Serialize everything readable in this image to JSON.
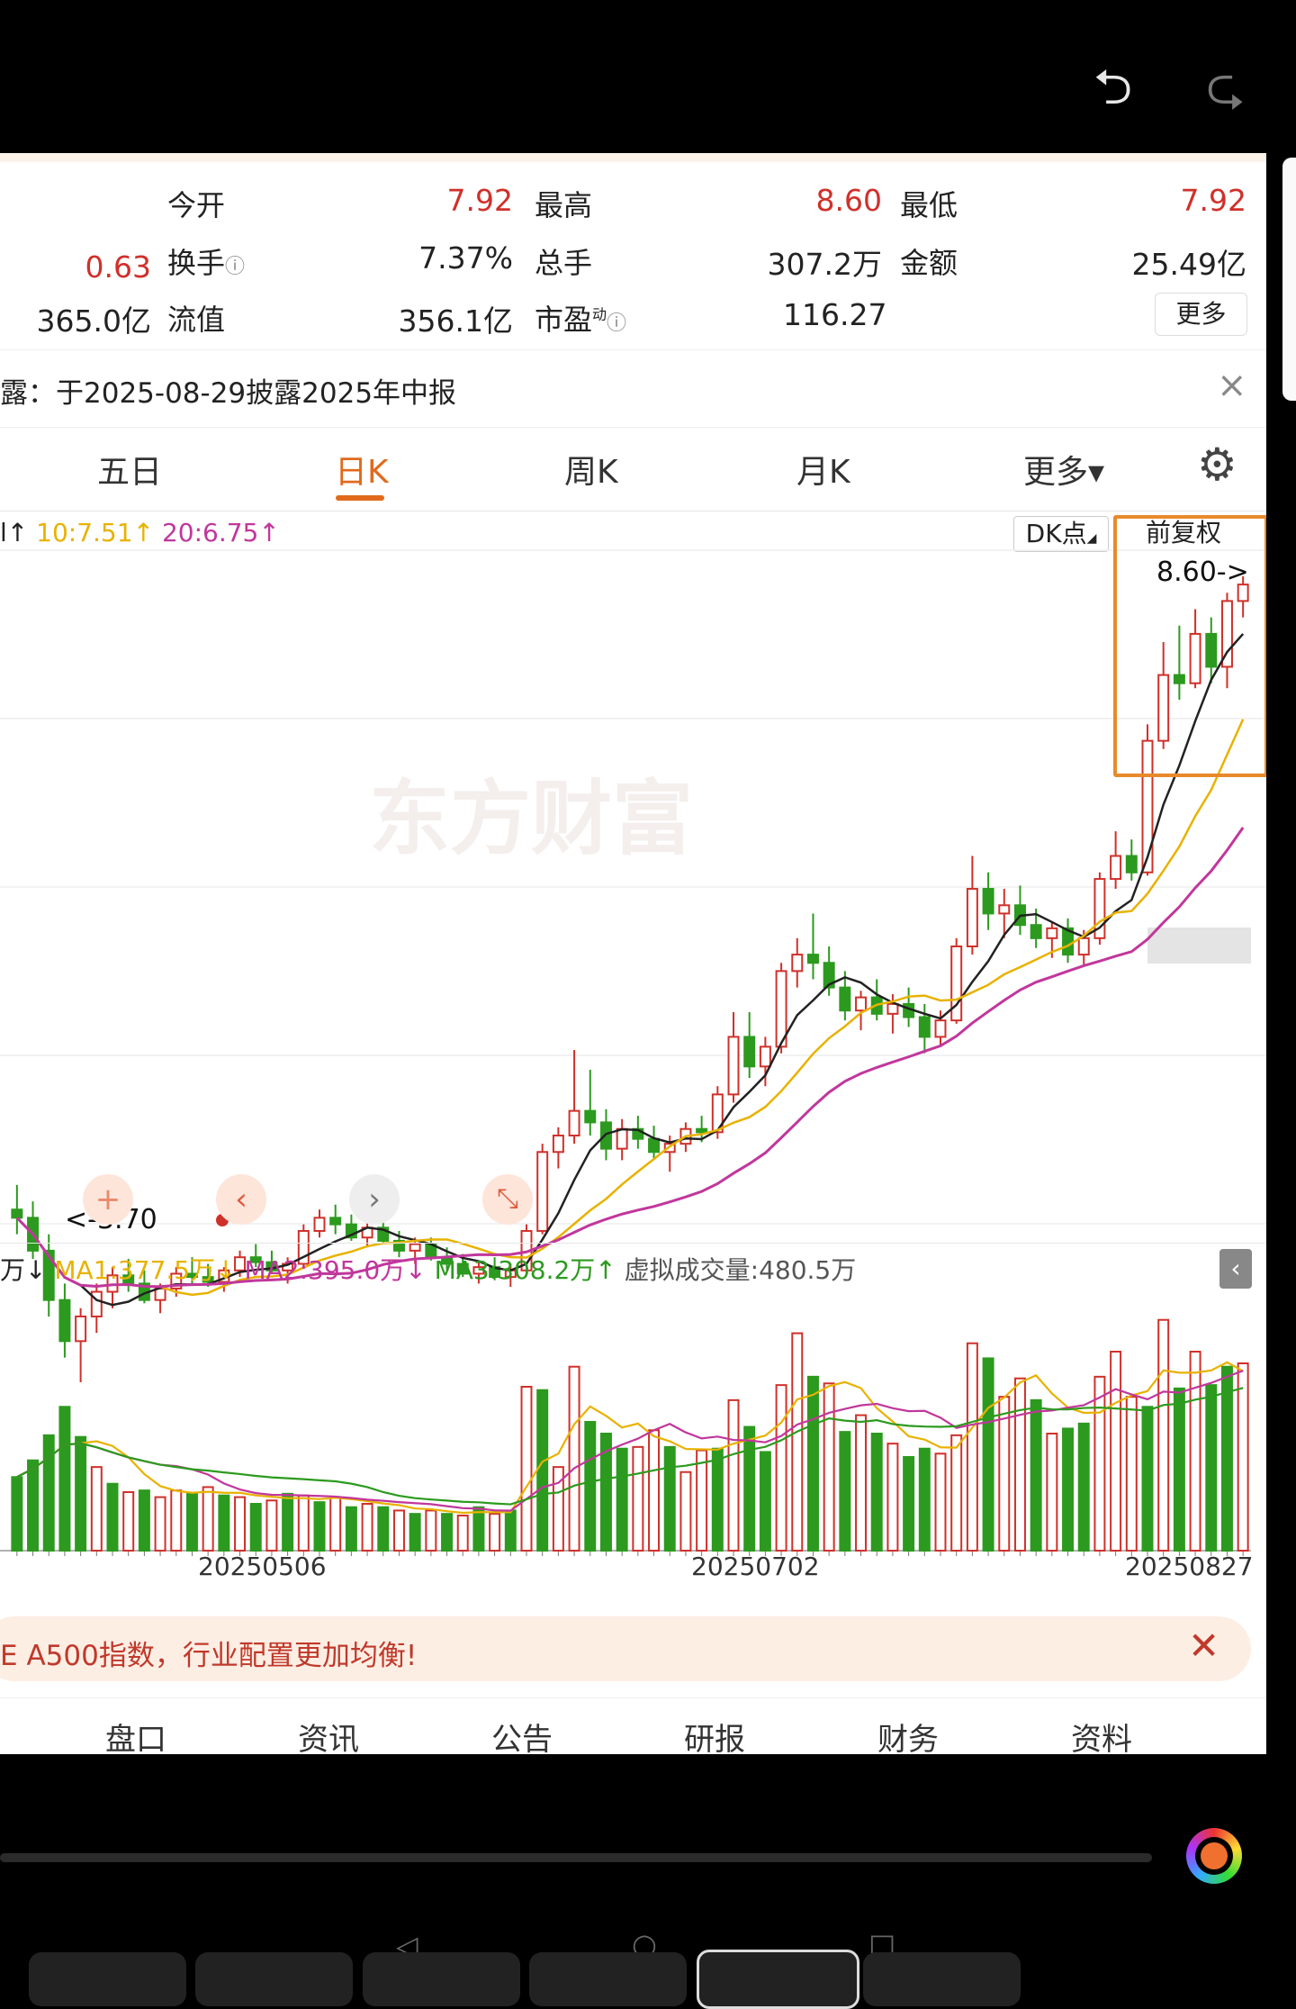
{
  "system": {
    "back_icon": "undo-arrow-icon",
    "forward_icon": "redo-arrow-icon"
  },
  "quote": {
    "row1": {
      "l1": "今开",
      "v1": "7.92",
      "l2": "最高",
      "v2": "8.60",
      "l3": "最低",
      "v3": "7.92"
    },
    "row2": {
      "v0": "0.63",
      "l1": "换手",
      "v1": "7.37%",
      "l2": "总手",
      "v2": "307.2万",
      "l3": "金额",
      "v3": "25.49亿"
    },
    "row3": {
      "v0": "365.0亿",
      "l1": "流值",
      "v1": "356.1亿",
      "l2": "市盈",
      "l2_sup": "动",
      "v2": "116.27"
    },
    "more": "更多"
  },
  "notice": {
    "text": "露：于2025-08-29披露2025年中报"
  },
  "tabs": [
    {
      "label": "五日",
      "active": false
    },
    {
      "label": "日K",
      "active": true
    },
    {
      "label": "周K",
      "active": false
    },
    {
      "label": "月K",
      "active": false
    },
    {
      "label": "更多▾",
      "active": false
    }
  ],
  "ma_line": {
    "m1": "l↑",
    "m2": "10:7.51↑",
    "m3": "20:6.75↑"
  },
  "chip_dk": "DK点",
  "chip_fq": "前复权",
  "price_high_label": "8.60->",
  "price_low_label": "<-3.70",
  "watermark": "东方财富",
  "vol_line": {
    "v0": "万↓",
    "v1": "MA1:377.5万↓",
    "v2": "MA2:395.0万↓",
    "v3": "MA3:308.2万↑",
    "v4": "虚拟成交量:480.5万"
  },
  "dates": [
    "20250506",
    "20250702",
    "20250827"
  ],
  "banner": {
    "text": "E A500指数，行业配置更加均衡!"
  },
  "bottom_nav": [
    "盘口",
    "资讯",
    "公告",
    "研报",
    "财务",
    "资料"
  ],
  "colors": {
    "up": "#d0302a",
    "down": "#2c9a1e",
    "ma5": "#222222",
    "ma10": "#e8b200",
    "ma20": "#c1379c",
    "accent": "#e06a1c"
  },
  "chart_data": {
    "type": "candlestick",
    "price_range": [
      3.7,
      8.6
    ],
    "candles": [
      [
        4.75,
        4.9,
        4.6,
        4.7
      ],
      [
        4.7,
        4.8,
        4.45,
        4.5
      ],
      [
        4.5,
        4.6,
        4.1,
        4.2
      ],
      [
        4.2,
        4.3,
        3.85,
        3.95
      ],
      [
        3.95,
        4.15,
        3.7,
        4.1
      ],
      [
        4.1,
        4.3,
        4.0,
        4.25
      ],
      [
        4.25,
        4.4,
        4.15,
        4.35
      ],
      [
        4.35,
        4.45,
        4.25,
        4.3
      ],
      [
        4.3,
        4.38,
        4.18,
        4.2
      ],
      [
        4.2,
        4.3,
        4.12,
        4.27
      ],
      [
        4.27,
        4.4,
        4.22,
        4.36
      ],
      [
        4.36,
        4.46,
        4.3,
        4.34
      ],
      [
        4.34,
        4.42,
        4.28,
        4.31
      ],
      [
        4.31,
        4.4,
        4.25,
        4.38
      ],
      [
        4.38,
        4.5,
        4.34,
        4.46
      ],
      [
        4.46,
        4.54,
        4.4,
        4.43
      ],
      [
        4.43,
        4.5,
        4.36,
        4.38
      ],
      [
        4.38,
        4.46,
        4.3,
        4.42
      ],
      [
        4.42,
        4.66,
        4.4,
        4.62
      ],
      [
        4.62,
        4.75,
        4.58,
        4.7
      ],
      [
        4.7,
        4.78,
        4.6,
        4.66
      ],
      [
        4.66,
        4.72,
        4.56,
        4.58
      ],
      [
        4.58,
        4.68,
        4.52,
        4.64
      ],
      [
        4.64,
        4.7,
        4.54,
        4.56
      ],
      [
        4.56,
        4.62,
        4.46,
        4.5
      ],
      [
        4.5,
        4.58,
        4.42,
        4.54
      ],
      [
        4.54,
        4.58,
        4.44,
        4.46
      ],
      [
        4.46,
        4.52,
        4.38,
        4.42
      ],
      [
        4.42,
        4.48,
        4.34,
        4.36
      ],
      [
        4.36,
        4.44,
        4.3,
        4.4
      ],
      [
        4.4,
        4.46,
        4.32,
        4.34
      ],
      [
        4.34,
        4.42,
        4.28,
        4.38
      ],
      [
        4.38,
        4.66,
        4.36,
        4.62
      ],
      [
        4.62,
        5.15,
        4.6,
        5.1
      ],
      [
        5.1,
        5.25,
        5.0,
        5.2
      ],
      [
        5.2,
        5.72,
        5.15,
        5.35
      ],
      [
        5.35,
        5.6,
        5.2,
        5.28
      ],
      [
        5.28,
        5.36,
        5.05,
        5.12
      ],
      [
        5.12,
        5.3,
        5.05,
        5.24
      ],
      [
        5.24,
        5.32,
        5.12,
        5.18
      ],
      [
        5.18,
        5.26,
        5.06,
        5.1
      ],
      [
        5.1,
        5.2,
        4.98,
        5.15
      ],
      [
        5.15,
        5.28,
        5.1,
        5.24
      ],
      [
        5.24,
        5.32,
        5.16,
        5.22
      ],
      [
        5.22,
        5.5,
        5.18,
        5.45
      ],
      [
        5.45,
        5.95,
        5.4,
        5.8
      ],
      [
        5.8,
        5.95,
        5.55,
        5.62
      ],
      [
        5.62,
        5.8,
        5.5,
        5.74
      ],
      [
        5.74,
        6.25,
        5.7,
        6.2
      ],
      [
        6.2,
        6.4,
        6.1,
        6.3
      ],
      [
        6.3,
        6.55,
        6.15,
        6.25
      ],
      [
        6.25,
        6.35,
        6.05,
        6.1
      ],
      [
        6.1,
        6.2,
        5.9,
        5.96
      ],
      [
        5.96,
        6.08,
        5.84,
        6.04
      ],
      [
        6.04,
        6.15,
        5.9,
        5.94
      ],
      [
        5.94,
        6.06,
        5.82,
        6.0
      ],
      [
        6.0,
        6.1,
        5.86,
        5.92
      ],
      [
        5.92,
        6.0,
        5.7,
        5.8
      ],
      [
        5.8,
        5.96,
        5.74,
        5.9
      ],
      [
        5.9,
        6.4,
        5.88,
        6.35
      ],
      [
        6.35,
        6.9,
        6.3,
        6.7
      ],
      [
        6.7,
        6.8,
        6.45,
        6.55
      ],
      [
        6.55,
        6.7,
        6.4,
        6.6
      ],
      [
        6.6,
        6.72,
        6.42,
        6.48
      ],
      [
        6.48,
        6.58,
        6.34,
        6.4
      ],
      [
        6.4,
        6.5,
        6.28,
        6.46
      ],
      [
        6.46,
        6.52,
        6.25,
        6.3
      ],
      [
        6.3,
        6.45,
        6.24,
        6.4
      ],
      [
        6.4,
        6.8,
        6.36,
        6.76
      ],
      [
        6.76,
        7.05,
        6.7,
        6.9
      ],
      [
        6.9,
        7.0,
        6.75,
        6.8
      ],
      [
        6.8,
        7.7,
        6.78,
        7.6
      ],
      [
        7.6,
        8.2,
        7.55,
        8.0
      ],
      [
        8.0,
        8.3,
        7.85,
        7.95
      ],
      [
        7.95,
        8.4,
        7.92,
        8.25
      ],
      [
        8.25,
        8.35,
        7.95,
        8.05
      ],
      [
        8.05,
        8.5,
        7.92,
        8.45
      ],
      [
        8.45,
        8.6,
        8.35,
        8.55
      ]
    ],
    "volume": [
      [
        4.4,
        0
      ],
      [
        5.4,
        0
      ],
      [
        6.9,
        0
      ],
      [
        8.6,
        0
      ],
      [
        6.8,
        0
      ],
      [
        5.0,
        1
      ],
      [
        4.0,
        0
      ],
      [
        3.5,
        1
      ],
      [
        3.6,
        0
      ],
      [
        3.2,
        1
      ],
      [
        3.6,
        1
      ],
      [
        3.4,
        0
      ],
      [
        3.8,
        1
      ],
      [
        3.3,
        0
      ],
      [
        3.2,
        1
      ],
      [
        2.8,
        0
      ],
      [
        3.0,
        1
      ],
      [
        3.4,
        0
      ],
      [
        3.3,
        1
      ],
      [
        2.9,
        0
      ],
      [
        3.2,
        1
      ],
      [
        2.6,
        0
      ],
      [
        2.8,
        1
      ],
      [
        2.6,
        0
      ],
      [
        2.4,
        1
      ],
      [
        2.2,
        0
      ],
      [
        2.4,
        1
      ],
      [
        2.2,
        0
      ],
      [
        2.1,
        1
      ],
      [
        2.6,
        0
      ],
      [
        2.2,
        1
      ],
      [
        2.4,
        0
      ],
      [
        9.8,
        1
      ],
      [
        9.6,
        0
      ],
      [
        5.0,
        1
      ],
      [
        11.0,
        1
      ],
      [
        7.7,
        0
      ],
      [
        7.0,
        0
      ],
      [
        6.1,
        0
      ],
      [
        6.2,
        1
      ],
      [
        7.2,
        1
      ],
      [
        6.2,
        0
      ],
      [
        4.7,
        1
      ],
      [
        6.0,
        1
      ],
      [
        6.1,
        0
      ],
      [
        9.0,
        1
      ],
      [
        7.4,
        0
      ],
      [
        5.9,
        0
      ],
      [
        9.9,
        1
      ],
      [
        13.0,
        1
      ],
      [
        10.4,
        0
      ],
      [
        10.0,
        1
      ],
      [
        7.1,
        0
      ],
      [
        8.1,
        1
      ],
      [
        7.0,
        0
      ],
      [
        6.4,
        1
      ],
      [
        5.6,
        0
      ],
      [
        6.1,
        0
      ],
      [
        5.8,
        1
      ],
      [
        6.9,
        1
      ],
      [
        12.4,
        1
      ],
      [
        11.5,
        0
      ],
      [
        9.2,
        1
      ],
      [
        10.3,
        1
      ],
      [
        9.0,
        0
      ],
      [
        7.0,
        1
      ],
      [
        7.3,
        0
      ],
      [
        7.6,
        0
      ],
      [
        10.4,
        1
      ],
      [
        11.9,
        1
      ],
      [
        9.2,
        1
      ],
      [
        8.6,
        0
      ],
      [
        13.8,
        1
      ],
      [
        9.7,
        0
      ],
      [
        11.9,
        1
      ],
      [
        9.9,
        0
      ],
      [
        11.0,
        0
      ],
      [
        11.2,
        1
      ]
    ]
  }
}
